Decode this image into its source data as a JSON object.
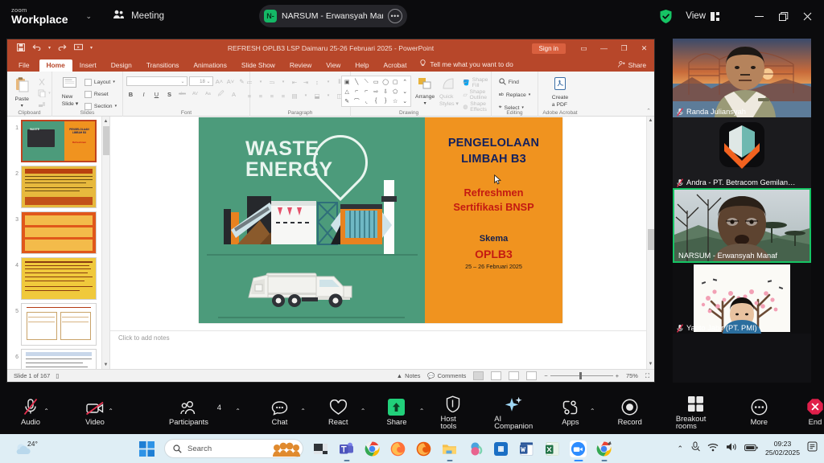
{
  "zoom_topbar": {
    "brand_small": "zoom",
    "brand_big": "Workplace",
    "caret": "⌄",
    "meeting_label": "Meeting",
    "meeting_pill": {
      "badge": "N-",
      "title": "NARSUM - Erwansyah Manaf's sc",
      "more": "•••"
    },
    "view_label": "View",
    "minimize": "—",
    "maximize": "❐",
    "close": "✕"
  },
  "powerpoint": {
    "document_title": "REFRESH  OPLB3  LSP Daimaru  25-26 Februari 2025  -  PowerPoint",
    "signin_label": "Sign in",
    "quick_access": [
      "save-icon",
      "undo-icon",
      "redo-icon",
      "present-icon",
      "customize-icon"
    ],
    "window_buttons": {
      "ribbon_display": "▭",
      "minimize": "—",
      "restore": "❐",
      "close": "✕"
    },
    "tabs": [
      "File",
      "Home",
      "Insert",
      "Design",
      "Transitions",
      "Animations",
      "Slide Show",
      "Review",
      "View",
      "Help",
      "Acrobat"
    ],
    "active_tab": "Home",
    "tell_me": "Tell me what you want to do",
    "share_label": "Share",
    "ribbon_groups": [
      {
        "name": "Clipboard",
        "big": "Paste",
        "items": [
          "Cut",
          "Copy",
          "Format Painter"
        ]
      },
      {
        "name": "Slides",
        "big": "New\nSlide",
        "items": [
          "Layout",
          "Reset",
          "Section"
        ]
      },
      {
        "name": "Font",
        "items": [
          "Bold",
          "Italic",
          "Underline",
          "Shadow",
          "Strikethrough",
          "Character Spacing",
          "Change Case",
          "Text Highlight",
          "Font Color"
        ]
      },
      {
        "name": "Paragraph",
        "items": [
          "Bullets",
          "Numbering",
          "Decrease Indent",
          "Increase Indent",
          "Line Spacing",
          "Text Direction",
          "Align Text",
          "Convert to SmartArt"
        ]
      },
      {
        "name": "Drawing",
        "big": "Arrange",
        "big2": "Quick\nStyles",
        "items": [
          "Shape Fill",
          "Shape Outline",
          "Shape Effects"
        ]
      },
      {
        "name": "Editing",
        "items": [
          "Find",
          "Replace",
          "Select"
        ]
      },
      {
        "name": "Adobe Acrobat",
        "big": "Create\na PDF",
        "items": []
      }
    ],
    "ribbon_buttons": {
      "paste": "Paste",
      "new_slide": "New Slide",
      "layout": "Layout",
      "reset": "Reset",
      "section": "Section",
      "bold": "B",
      "italic": "I",
      "underline": "U",
      "shadow": "S",
      "strikethrough": "abc",
      "char_spacing": "AV",
      "change_case": "Aa",
      "arrange": "Arrange",
      "quick_styles": "Quick Styles",
      "shape_fill": "Shape Fill",
      "shape_outline": "Shape Outline",
      "shape_effects": "Shape Effects",
      "find": "Find",
      "replace": "Replace",
      "select": "Select",
      "create_pdf": "Create a PDF"
    },
    "slide": {
      "left_panel": {
        "heading_line1": "WASTE",
        "heading_line2": "ENERGY"
      },
      "right_panel": {
        "title_line1": "PENGELOLAAN",
        "title_line2": "LIMBAH B3",
        "sub_line1": "Refreshmen",
        "sub_line2": "Sertifikasi BNSP",
        "skema_label": "Skema",
        "skema_code": "OPLB3",
        "date": "25 – 26  Februari  2025"
      },
      "colors": {
        "left_bg": "#4c9b7b",
        "right_bg": "#f0931f",
        "title": "#12205e",
        "accent": "#c41a12"
      }
    },
    "thumbnails": [
      {
        "num": "1"
      },
      {
        "num": "2"
      },
      {
        "num": "3"
      },
      {
        "num": "4"
      },
      {
        "num": "5"
      },
      {
        "num": "6"
      }
    ],
    "selected_thumbnail": "1",
    "notes_placeholder": "Click to add notes",
    "status": {
      "slide_indicator": "Slide 1 of 167",
      "notes_label": "Notes",
      "comments_label": "Comments",
      "zoom_out": "−",
      "zoom_in": "+",
      "zoom_level": "75%"
    }
  },
  "tiles": [
    {
      "name": "Randa Juliansyah",
      "muted": true,
      "active": false
    },
    {
      "name": "Andra - PT. Betracom Gemilan…",
      "muted": true,
      "active": false
    },
    {
      "name": "NARSUM - Erwansyah Manaf",
      "muted": false,
      "active": true
    },
    {
      "name": "Yapto Jabir (PT. PMI)",
      "muted": true,
      "active": false
    }
  ],
  "controls": [
    {
      "label": "Audio",
      "icon": "microphone-muted-icon",
      "caret": "⌃",
      "count": ""
    },
    {
      "label": "Video",
      "icon": "camera-muted-icon",
      "caret": "⌃",
      "count": ""
    },
    {
      "label": "Participants",
      "icon": "people-icon",
      "caret": "⌃",
      "count": "4"
    },
    {
      "label": "Chat",
      "icon": "chat-bubble-icon",
      "caret": "⌃",
      "count": ""
    },
    {
      "label": "React",
      "icon": "heart-icon",
      "caret": "⌃",
      "count": ""
    },
    {
      "label": "Share",
      "icon": "share-screen-icon",
      "caret": "⌃",
      "count": ""
    },
    {
      "label": "Host tools",
      "icon": "shield-icon",
      "caret": "",
      "count": ""
    },
    {
      "label": "AI Companion",
      "icon": "sparkle-icon",
      "caret": "",
      "count": ""
    },
    {
      "label": "Apps",
      "icon": "apps-icon",
      "caret": "⌃",
      "count": ""
    },
    {
      "label": "Record",
      "icon": "record-icon",
      "caret": "",
      "count": ""
    },
    {
      "label": "Breakout rooms",
      "icon": "grid-icon",
      "caret": "",
      "count": ""
    },
    {
      "label": "More",
      "icon": "ellipsis-icon",
      "caret": "",
      "count": ""
    },
    {
      "label": "End",
      "icon": "end-call-icon",
      "caret": "",
      "count": ""
    }
  ],
  "taskbar": {
    "weather_temp": "24°",
    "search_placeholder": "Search",
    "apps": [
      "start-icon",
      "search-box",
      "widget-icon",
      "explorer-dark-icon",
      "teams-icon",
      "chrome-icon",
      "firefox-icon",
      "firefox2-icon",
      "file-explorer-icon",
      "copilot-icon",
      "store-icon",
      "word-icon",
      "excel-icon",
      "zoom-icon",
      "chrome2-icon"
    ],
    "tray": [
      "chevron-up-icon",
      "mic-icon",
      "network-icon",
      "wifi-icon",
      "volume-icon",
      "battery-icon"
    ],
    "time": "09:23",
    "date": "25/02/2025"
  }
}
